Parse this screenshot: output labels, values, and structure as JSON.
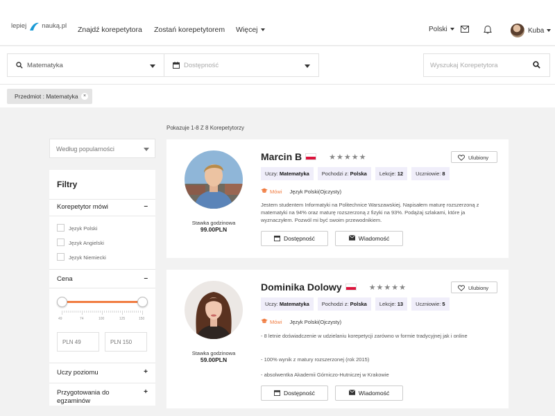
{
  "header": {
    "logo": {
      "word1": "lepiej",
      "word2": "nauką.pl"
    },
    "nav": [
      {
        "label": "Znajdź korepetytora"
      },
      {
        "label": "Zostań korepetytorem"
      },
      {
        "label": "Więcej"
      }
    ],
    "language": "Polski",
    "user": {
      "name": "Kuba"
    },
    "icons": [
      "envelope-icon",
      "bell-icon"
    ]
  },
  "search": {
    "subject_value": "Matematyka",
    "availability_placeholder": "Dostępność",
    "tutor_placeholder": "Wyszukaj Korepetytora"
  },
  "active_filter": {
    "label": "Przedmiot : Matematyka",
    "remove": "×"
  },
  "results_count": "Pokazuje 1-8 Z 8 Korepetytorzy",
  "sort": {
    "value": "Według popularności"
  },
  "filters": {
    "title": "Filtry",
    "sections": [
      {
        "label": "Korepetytor mówi",
        "toggle": "–"
      },
      {
        "label": "Cena",
        "toggle": "–"
      },
      {
        "label": "Uczy poziomu",
        "toggle": "+"
      },
      {
        "label": "Przygotowania do egzaminów",
        "toggle": "+"
      }
    ],
    "languages": [
      "Język Polski",
      "Język Angielski",
      "Język Niemiecki"
    ],
    "price": {
      "range_min": 49,
      "range_max": 150,
      "ticks": [
        "49",
        "74",
        "100",
        "125",
        "150"
      ],
      "min_placeholder": "PLN 49",
      "max_placeholder": "PLN 150"
    }
  },
  "tutors": [
    {
      "name": "Marcin B",
      "stars": "★★★★★",
      "favorite_label": "Ulubiony",
      "tags": [
        {
          "key": "Uczy:",
          "value": "Matematyka"
        },
        {
          "key": "Pochodzi z:",
          "value": "Polska"
        },
        {
          "key": "Lekcje:",
          "value": "12"
        },
        {
          "key": "Uczniowie:",
          "value": "8"
        }
      ],
      "speaks_label": "Mówi",
      "speaks_value": "Język Polski(Ojczysty)",
      "description": [
        "Jestem studentem Informatyki na Politechnice Warszawskiej. Napisałem maturę rozszerzoną z matematyki na 94% oraz maturę rozszerzoną z fizyki na 93%. Podążaj szlakami, które ja wyznaczyłem. Pozwól mi być swoim przewodnikiem."
      ],
      "rate_label": "Stawka godzinowa",
      "rate_value": "99.00PLN",
      "availability_button": "Dostępność",
      "message_button": "Wiadomość"
    },
    {
      "name": "Dominika Dolowy",
      "stars": "★★★★★",
      "favorite_label": "Ulubiony",
      "tags": [
        {
          "key": "Uczy:",
          "value": "Matematyka"
        },
        {
          "key": "Pochodzi z:",
          "value": "Polska"
        },
        {
          "key": "Lekcje:",
          "value": "13"
        },
        {
          "key": "Uczniowie:",
          "value": "5"
        }
      ],
      "speaks_label": "Mówi",
      "speaks_value": "Język Polski(Ojczysty)",
      "description": [
        "- 8 letnie doświadczenie w udzielaniu korepetycji zarówno w formie tradycyjnej jak i online",
        "- 100% wynik z matury rozszerzonej (rok 2015)",
        "- absolwentka Akademii Górniczo-Hutniczej w Krakowie"
      ],
      "rate_label": "Stawka godzinowa",
      "rate_value": "59.00PLN",
      "availability_button": "Dostępność",
      "message_button": "Wiadomość"
    }
  ],
  "colors": {
    "accent": "#f07b3f",
    "tag_bg": "#f0eefa",
    "logo_blue": "#1a9ad6"
  }
}
